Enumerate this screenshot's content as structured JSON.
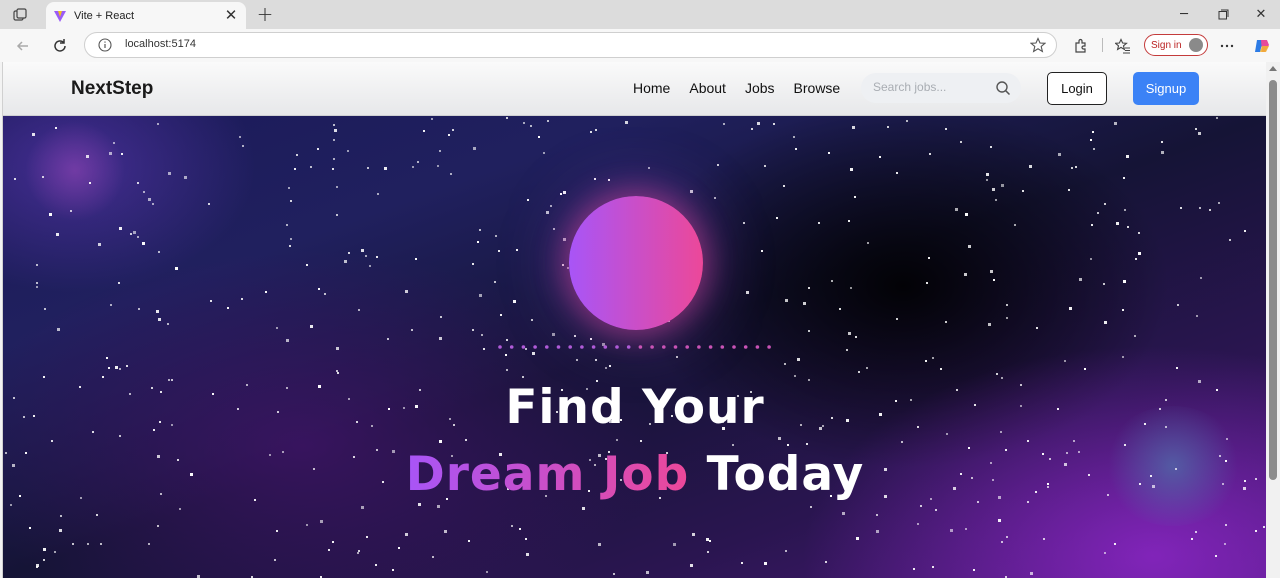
{
  "browser": {
    "tab_title": "Vite + React",
    "url": "localhost:5174",
    "signin_label": "Sign in"
  },
  "site": {
    "brand": "NextStep",
    "nav": [
      {
        "label": "Home"
      },
      {
        "label": "About"
      },
      {
        "label": "Jobs"
      },
      {
        "label": "Browse"
      }
    ],
    "search_placeholder": "Search jobs...",
    "login_label": "Login",
    "signup_label": "Signup"
  },
  "hero": {
    "line1": "Find Your",
    "line2_accent": "Dream Job",
    "line2_rest": "Today"
  },
  "colors": {
    "accent_blue": "#3b82f6",
    "gradient_start": "#a855f7",
    "gradient_end": "#ec4899"
  }
}
